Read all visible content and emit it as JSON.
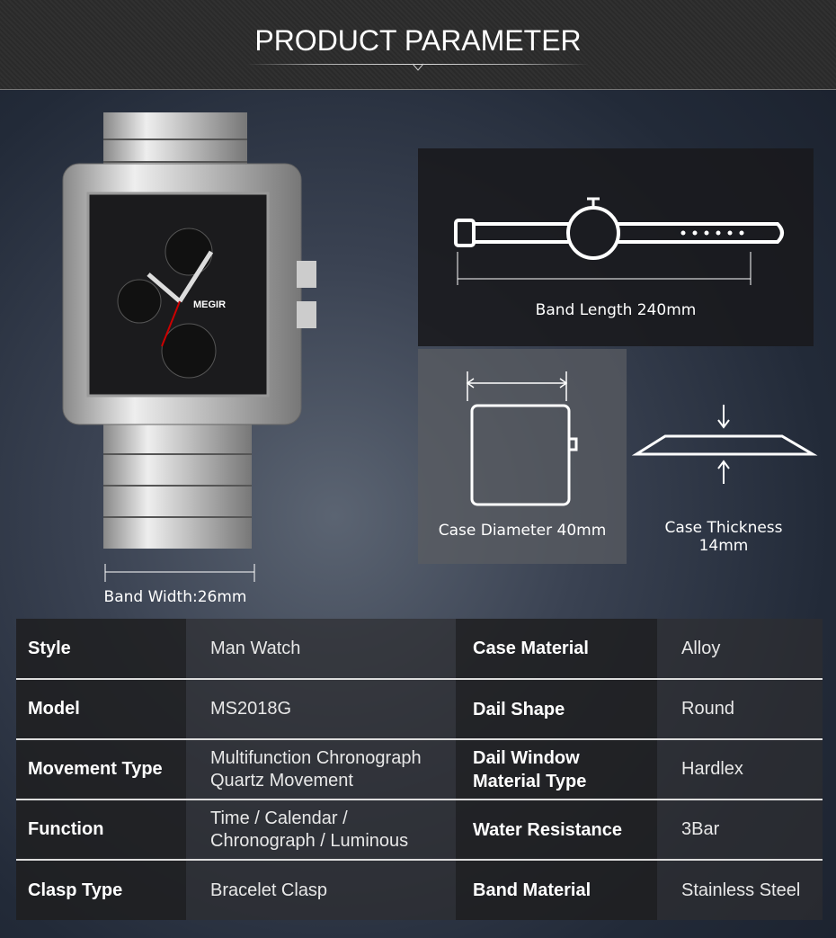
{
  "header": {
    "title": "PRODUCT PARAMETER"
  },
  "dimensions": {
    "band_width": "Band Width:26mm",
    "band_length": "Band Length 240mm",
    "case_diameter": "Case Diameter 40mm",
    "case_thickness_line1": "Case Thickness",
    "case_thickness_line2": "14mm"
  },
  "watch": {
    "brand": "MEGIR"
  },
  "specs": [
    {
      "label": "Style",
      "value": "Man Watch",
      "label2": "Case Material",
      "value2": "Alloy"
    },
    {
      "label": "Model",
      "value": "MS2018G",
      "label2": "Dail Shape",
      "value2": "Round"
    },
    {
      "label": "Movement Type",
      "value": "Multifunction Chronograph Quartz Movement",
      "label2": "Dail Window Material Type",
      "value2": "Hardlex"
    },
    {
      "label": "Function",
      "value": "Time  / Calendar / Chronograph / Luminous",
      "label2": "Water Resistance",
      "value2": "3Bar"
    },
    {
      "label": "Clasp Type",
      "value": "Bracelet Clasp",
      "label2": "Band Material",
      "value2": "Stainless Steel"
    }
  ]
}
